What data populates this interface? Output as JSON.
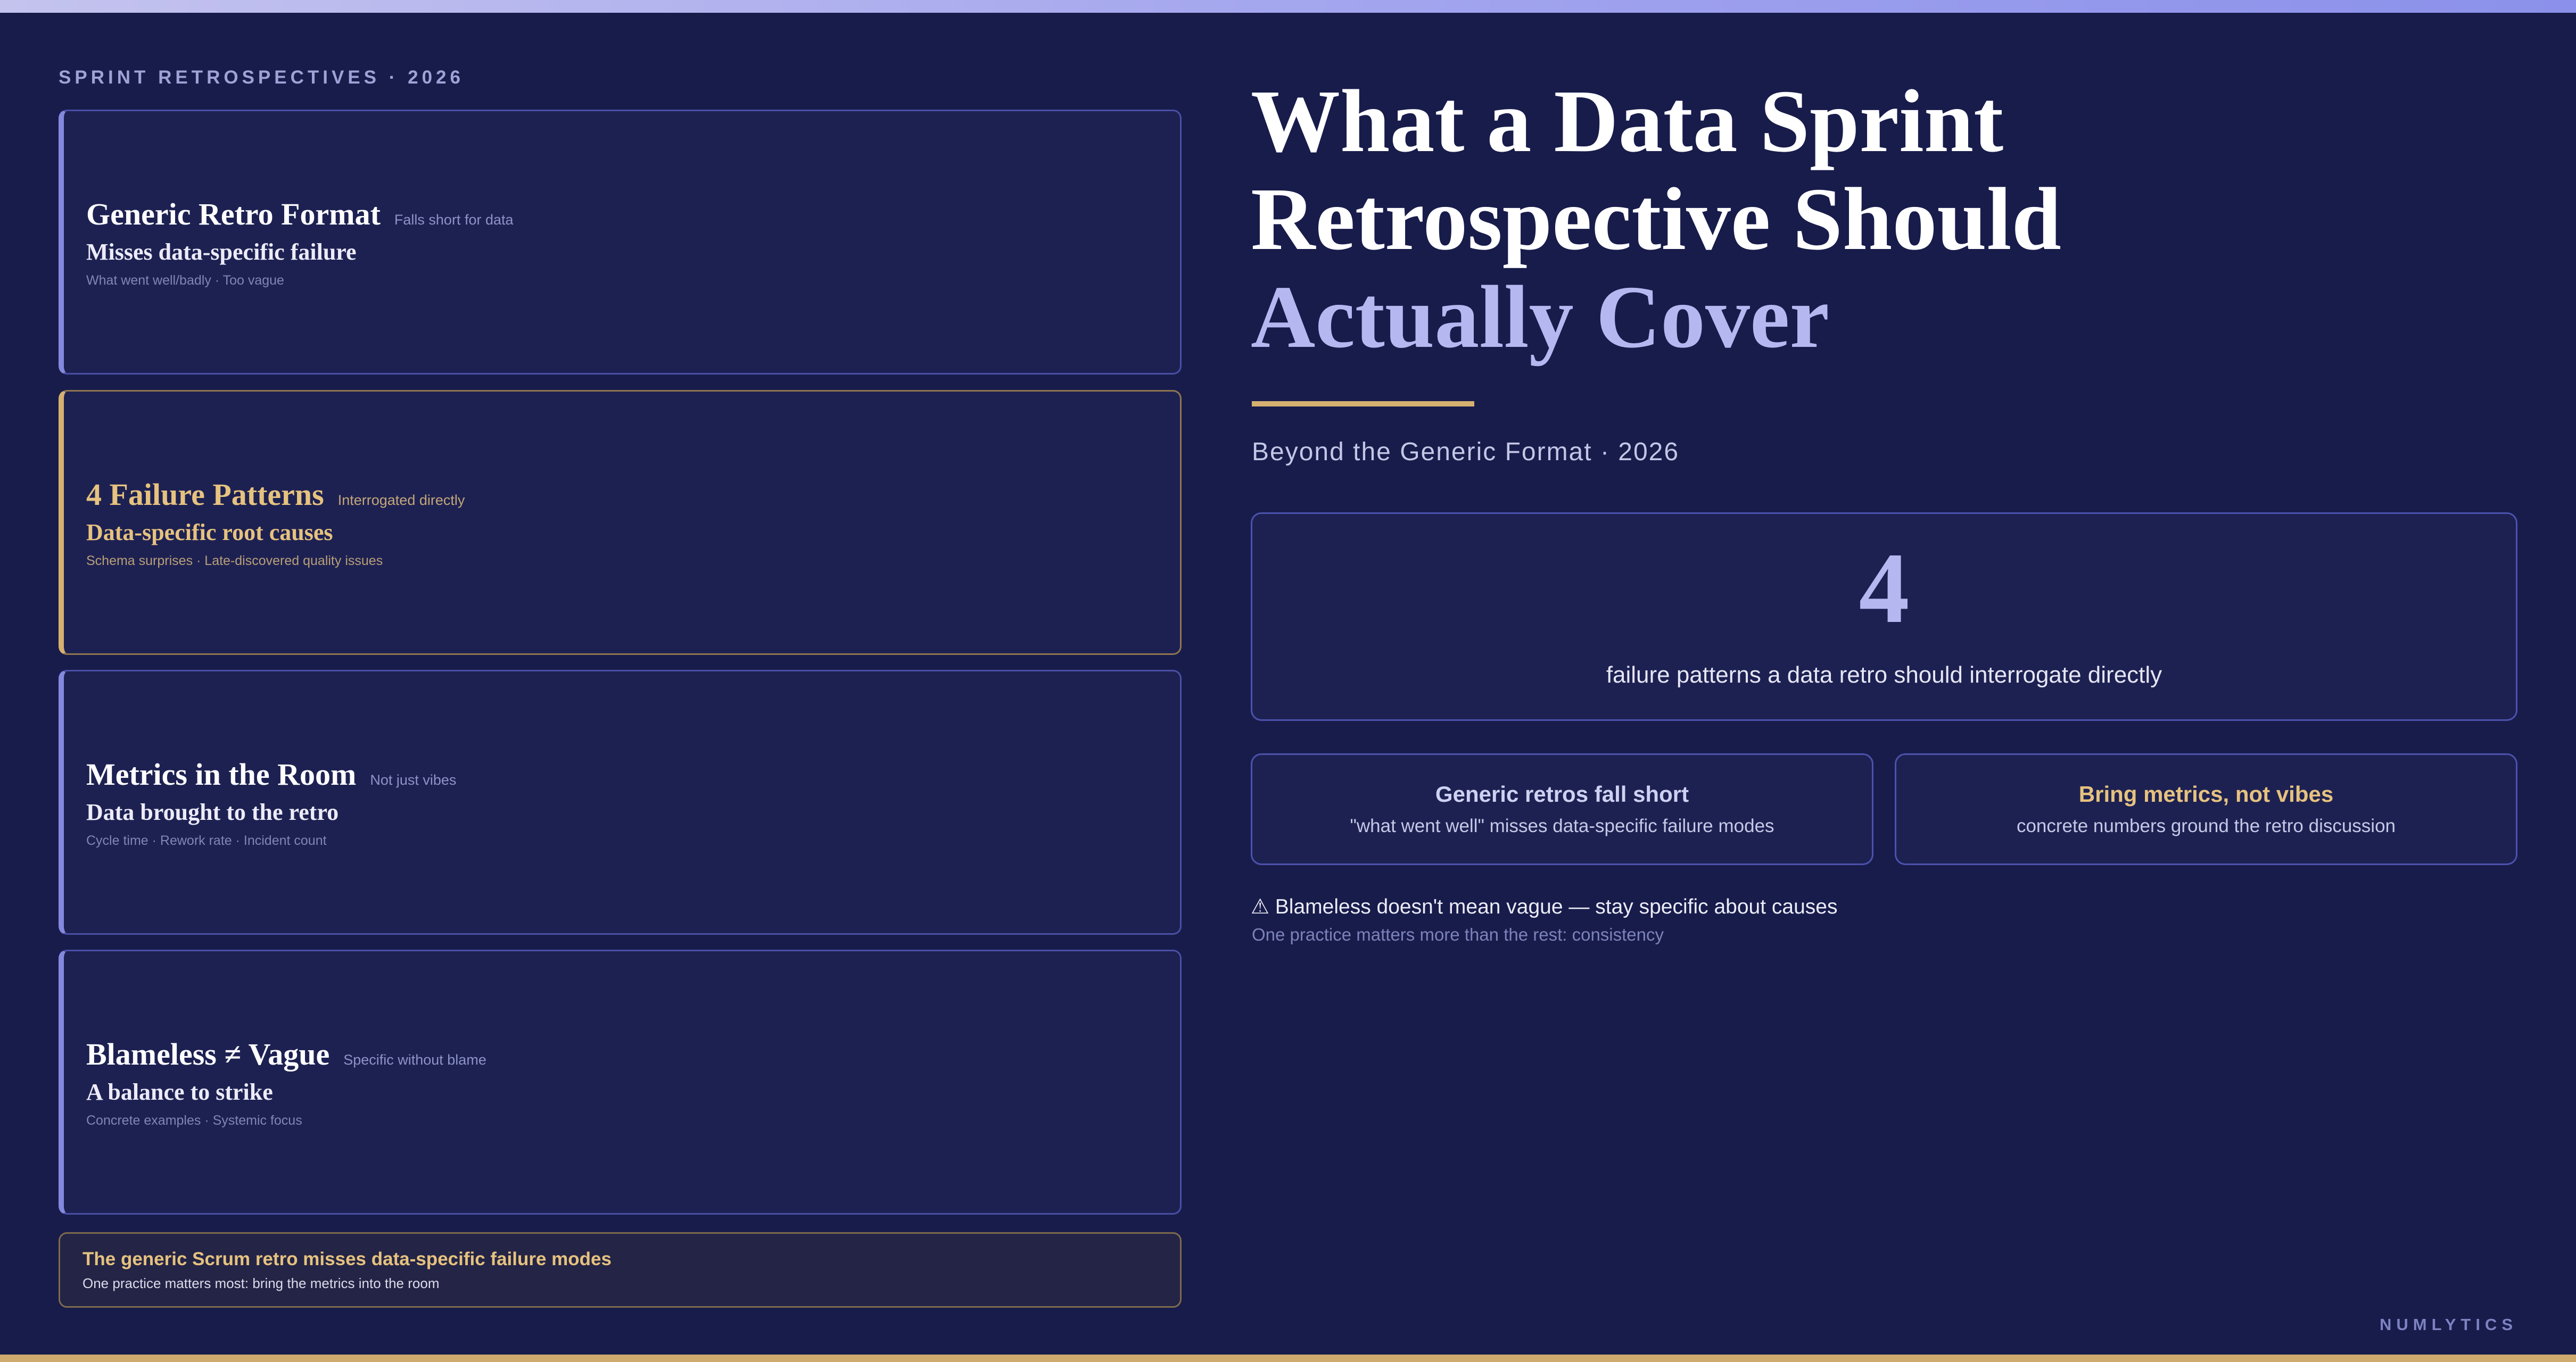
{
  "eyebrow": "SPRINT RETROSPECTIVES · 2026",
  "cards": [
    {
      "title": "Generic Retro Format",
      "tag": "Falls short for data",
      "subtitle": "Misses data-specific failure",
      "meta": "What went well/badly · Too vague"
    },
    {
      "title": "4 Failure Patterns",
      "tag": "Interrogated directly",
      "subtitle": "Data-specific root causes",
      "meta": "Schema surprises · Late-discovered quality issues"
    },
    {
      "title": "Metrics in the Room",
      "tag": "Not just vibes",
      "subtitle": "Data brought to the retro",
      "meta": "Cycle time · Rework rate · Incident count"
    },
    {
      "title": "Blameless ≠ Vague",
      "tag": "Specific without blame",
      "subtitle": "A balance to strike",
      "meta": "Concrete examples · Systemic focus"
    }
  ],
  "note": {
    "title": "The generic Scrum retro misses data-specific failure modes",
    "subtitle": "One practice matters most: bring the metrics into the room"
  },
  "headline": {
    "line1": "What a Data Sprint",
    "line2": "Retrospective Should",
    "line3": "Actually Cover"
  },
  "subtitle": "Beyond the Generic Format · 2026",
  "stat": {
    "value": "4",
    "caption": "failure patterns a data retro should interrogate directly"
  },
  "points": [
    {
      "title": "Generic retros fall short",
      "text": "\"what went well\" misses data-specific failure modes"
    },
    {
      "title": "Bring metrics, not vibes",
      "text": "concrete numbers ground the retro discussion"
    }
  ],
  "warning": {
    "icon": "warning-icon",
    "text": "⚠ Blameless doesn't mean vague — stay specific about causes",
    "subtext": "One practice matters more than the rest: consistency"
  },
  "brand": "NUMLYTICS",
  "colors": {
    "background": "#181c4b",
    "card": "#1d2152",
    "accent_gold": "#d5b070",
    "accent_lavender": "#b5b8f0",
    "border": "#4c52ad"
  }
}
